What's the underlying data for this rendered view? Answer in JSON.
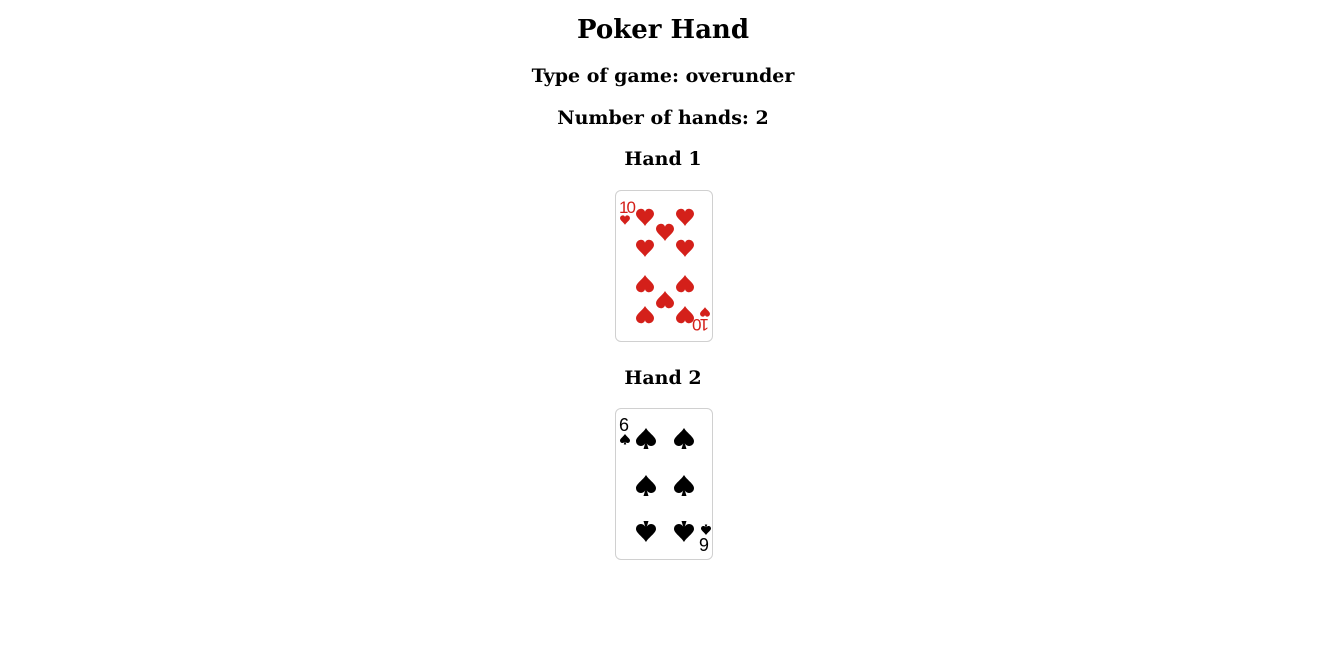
{
  "page": {
    "title": "Poker Hand",
    "game_type": "Type of game: overunder",
    "hand_count": "Number of hands: 2"
  },
  "hands": [
    {
      "heading": "Hand 1",
      "card": {
        "rank": "10",
        "suit": "hearts",
        "suit_icon": "heart-icon",
        "color": "#d4201a"
      }
    },
    {
      "heading": "Hand 2",
      "card": {
        "rank": "6",
        "suit": "spades",
        "suit_icon": "spade-icon",
        "color": "#000000"
      }
    }
  ]
}
